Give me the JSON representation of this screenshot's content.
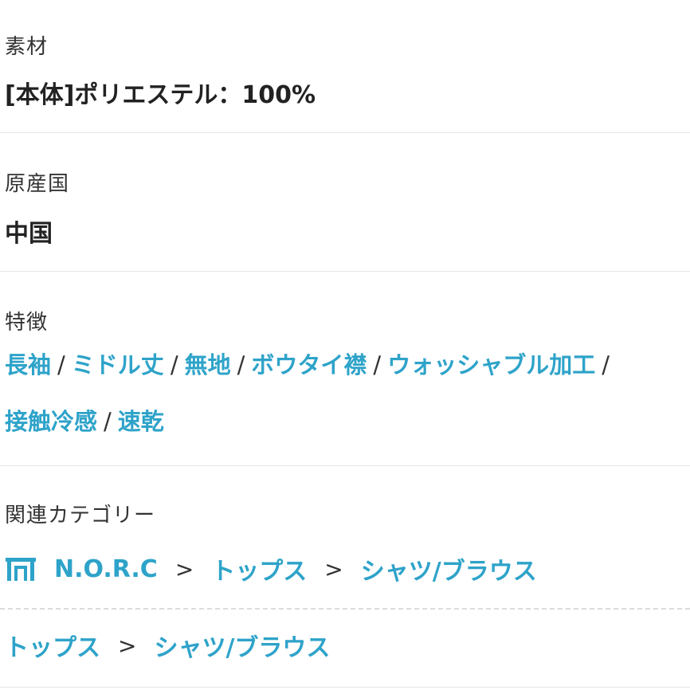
{
  "material": {
    "label": "素材",
    "value": "[本体]ポリエステル：100%"
  },
  "origin": {
    "label": "原産国",
    "value": "中国"
  },
  "features": {
    "label": "特徴",
    "separator": "/",
    "tags": [
      "長袖",
      "ミドル丈",
      "無地",
      "ボウタイ襟",
      "ウォッシャブル加工",
      "接触冷感",
      "速乾"
    ]
  },
  "related_categories": {
    "label": "関連カテゴリー",
    "separator": ">",
    "shop_icon": "shop-icon",
    "breadcrumb_1": [
      "N.O.R.C",
      "トップス",
      "シャツ/ブラウス"
    ],
    "breadcrumb_2": [
      "トップス",
      "シャツ/ブラウス"
    ]
  },
  "colors": {
    "link": "#2ea3c9",
    "text": "#222222",
    "divider": "#e6e6e6"
  }
}
